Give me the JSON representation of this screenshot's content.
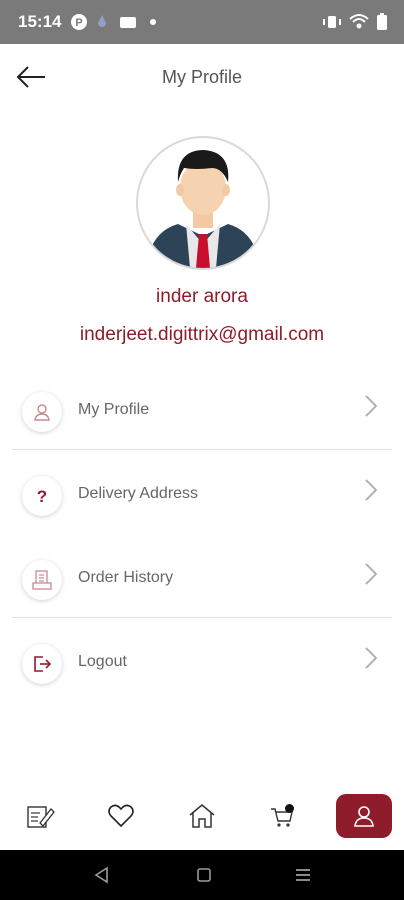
{
  "status_bar": {
    "time": "15:14"
  },
  "header": {
    "title": "My Profile"
  },
  "profile": {
    "name": "inder arora",
    "email": "inderjeet.digittrix@gmail.com"
  },
  "menu": {
    "items": [
      {
        "label": "My Profile",
        "icon": "user-icon"
      },
      {
        "label": "Delivery Address",
        "icon": "question-icon"
      },
      {
        "label": "Order History",
        "icon": "receipt-icon"
      },
      {
        "label": "Logout",
        "icon": "logout-icon"
      }
    ]
  },
  "bottom_nav": {
    "items": [
      {
        "icon": "edit-icon",
        "active": false
      },
      {
        "icon": "heart-icon",
        "active": false
      },
      {
        "icon": "home-icon",
        "active": false
      },
      {
        "icon": "cart-icon",
        "active": false
      },
      {
        "icon": "user-icon",
        "active": true
      }
    ]
  },
  "colors": {
    "accent": "#8e1c2a",
    "status_bar": "#7a7a7a",
    "text_muted": "#666666"
  }
}
